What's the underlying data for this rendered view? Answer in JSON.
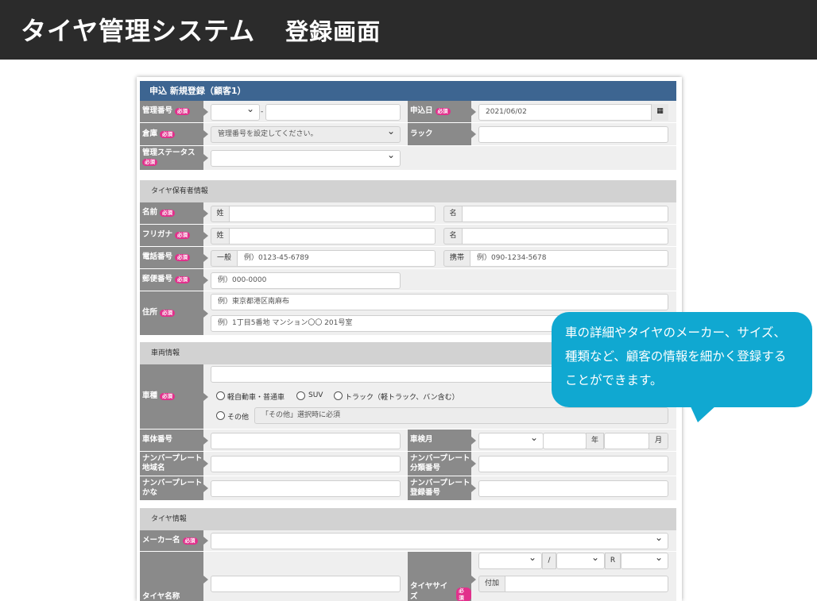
{
  "banner": {
    "title": "タイヤ管理システム",
    "subtitle": "登録画面"
  },
  "form": {
    "header": "申込 新規登録（顧客1）",
    "req": "必須",
    "kanri_bango": "管理番号",
    "hyphen": "-",
    "moushikomi_bi": "申込日",
    "moushikomi_bi_value": "2021/06/02",
    "souko": "倉庫",
    "souko_placeholder": "管理番号を設定してください。",
    "rack": "ラック",
    "status": "管理ステータス",
    "sec_owner": "タイヤ保有者情報",
    "namae": "名前",
    "sei": "姓",
    "mei": "名",
    "furigana": "フリガナ",
    "denwa": "電話番号",
    "ippan": "一般",
    "ippan_ph": "例）0123-45-6789",
    "keitai": "携帯",
    "keitai_ph": "例）090-1234-5678",
    "yubin": "郵便番号",
    "yubin_ph": "例）000-0000",
    "jusho": "住所",
    "jusho_ph1": "例）東京都港区南麻布",
    "jusho_ph2": "例）1丁目5番地 マンション〇〇 201号室",
    "sec_vehicle": "車両情報",
    "shashu": "車種",
    "radio1": "軽自動車・普通車",
    "radio2": "SUV",
    "radio3": "トラック（軽トラック、バン含む）",
    "radio4": "その他",
    "sonota_ph": "「その他」選択時に必須",
    "shatai": "車体番号",
    "shaken": "車検月",
    "nen": "年",
    "tsuki": "月",
    "plate_area_1": "ナンバープレート",
    "plate_area_2": "地域名",
    "plate_class_1": "ナンバープレート",
    "plate_class_2": "分類番号",
    "plate_kana_1": "ナンバープレート",
    "plate_kana_2": "かな",
    "plate_reg_1": "ナンバープレート",
    "plate_reg_2": "登録番号",
    "sec_tire": "タイヤ情報",
    "maker": "メーカー名",
    "tire_name": "タイヤ名称",
    "tire_size": "タイヤサイズ",
    "slash": "/",
    "r": "R",
    "fuka": "付加"
  },
  "bubble": {
    "line1": "車の詳細やタイヤのメーカー、サイズ、",
    "line2": "種類など、顧客の情報を細かく登録する",
    "line3": "ことができます。"
  },
  "colors": {
    "header": "#3d6591",
    "label": "#8a8a8a",
    "required": "#e2308c",
    "bubble": "#10a8d1",
    "banner": "#2b2b2b"
  }
}
